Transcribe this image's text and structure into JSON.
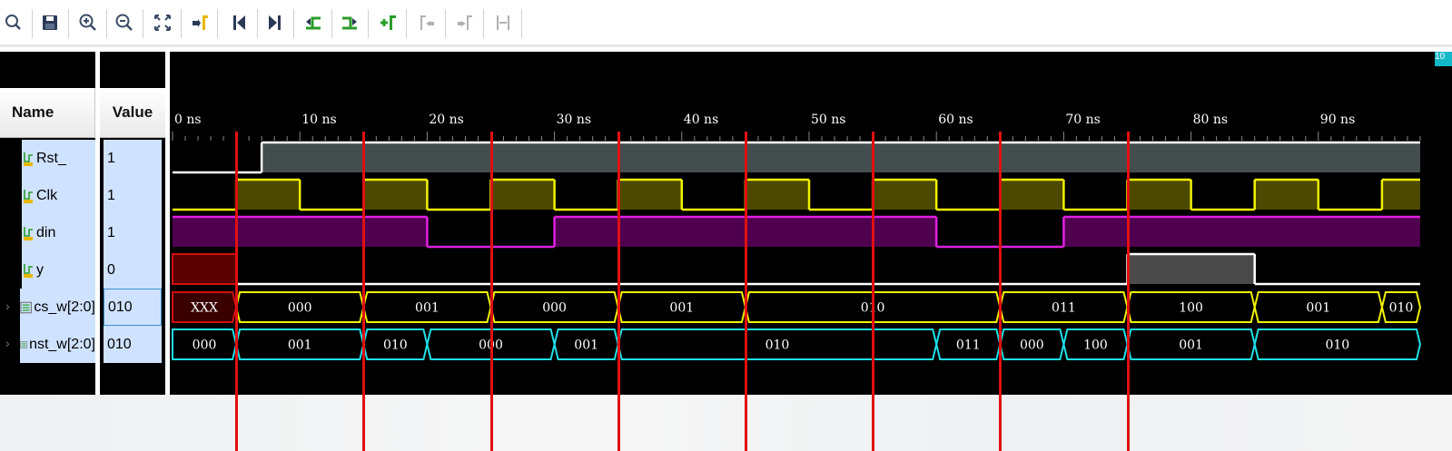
{
  "toolbar": {
    "buttons": [
      {
        "name": "search-icon",
        "enabled": true
      },
      {
        "name": "save-icon",
        "enabled": true
      },
      {
        "name": "zoom-in-icon",
        "enabled": true
      },
      {
        "name": "zoom-out-icon",
        "enabled": true
      },
      {
        "name": "zoom-fit-icon",
        "enabled": true
      },
      {
        "name": "go-to-cursor-icon",
        "enabled": true
      },
      {
        "name": "go-to-start-icon",
        "enabled": true
      },
      {
        "name": "go-to-end-icon",
        "enabled": true
      },
      {
        "name": "previous-transition-icon",
        "enabled": true
      },
      {
        "name": "next-transition-icon",
        "enabled": true
      },
      {
        "name": "add-marker-icon",
        "enabled": true
      },
      {
        "name": "previous-marker-icon",
        "enabled": false
      },
      {
        "name": "next-marker-icon",
        "enabled": false
      },
      {
        "name": "swap-cursors-icon",
        "enabled": false
      }
    ]
  },
  "headers": {
    "name": "Name",
    "value": "Value"
  },
  "signals": [
    {
      "name": "Rst_",
      "value": "1",
      "kind": "bit",
      "icon": "logic-signal-icon",
      "color": "#ffffff",
      "fill": "#444d4d"
    },
    {
      "name": "Clk",
      "value": "1",
      "kind": "bit",
      "icon": "logic-signal-icon",
      "color": "#f2f200",
      "fill": "#4d4a00"
    },
    {
      "name": "din",
      "value": "1",
      "kind": "bit",
      "icon": "logic-signal-icon",
      "color": "#e020e0",
      "fill": "#4f004f"
    },
    {
      "name": "y",
      "value": "0",
      "kind": "bit",
      "icon": "logic-signal-icon",
      "color": "#ffffff",
      "fill": "#4a4a4a"
    },
    {
      "name": "cs_w[2:0]",
      "value": "010",
      "kind": "bus",
      "icon": "bus-signal-icon",
      "color": "#f2f200",
      "selected": true
    },
    {
      "name": "nst_w[2:0]",
      "value": "010",
      "kind": "bus",
      "icon": "bus-signal-icon",
      "color": "#20e0e8"
    }
  ],
  "timeline": {
    "unit": "ns",
    "range_ns": [
      0,
      98
    ],
    "ticks": [
      {
        "t": 0,
        "label": "0 ns"
      },
      {
        "t": 10,
        "label": "10 ns"
      },
      {
        "t": 20,
        "label": "20 ns"
      },
      {
        "t": 30,
        "label": "30 ns"
      },
      {
        "t": 40,
        "label": "40 ns"
      },
      {
        "t": 50,
        "label": "50 ns"
      },
      {
        "t": 60,
        "label": "60 ns"
      },
      {
        "t": 70,
        "label": "70 ns"
      },
      {
        "t": 80,
        "label": "80 ns"
      },
      {
        "t": 90,
        "label": "90 ns"
      }
    ],
    "corner_label": "10"
  },
  "waves": {
    "Rst_": [
      {
        "t": 0,
        "v": 0
      },
      {
        "t": 7,
        "v": 1
      }
    ],
    "Clk": [
      {
        "t": 0,
        "v": 0
      },
      {
        "t": 5,
        "v": 1
      },
      {
        "t": 10,
        "v": 0
      },
      {
        "t": 15,
        "v": 1
      },
      {
        "t": 20,
        "v": 0
      },
      {
        "t": 25,
        "v": 1
      },
      {
        "t": 30,
        "v": 0
      },
      {
        "t": 35,
        "v": 1
      },
      {
        "t": 40,
        "v": 0
      },
      {
        "t": 45,
        "v": 1
      },
      {
        "t": 50,
        "v": 0
      },
      {
        "t": 55,
        "v": 1
      },
      {
        "t": 60,
        "v": 0
      },
      {
        "t": 65,
        "v": 1
      },
      {
        "t": 70,
        "v": 0
      },
      {
        "t": 75,
        "v": 1
      },
      {
        "t": 80,
        "v": 0
      },
      {
        "t": 85,
        "v": 1
      },
      {
        "t": 90,
        "v": 0
      },
      {
        "t": 95,
        "v": 1
      }
    ],
    "din": [
      {
        "t": 0,
        "v": 1
      },
      {
        "t": 20,
        "v": 0
      },
      {
        "t": 30,
        "v": 1
      },
      {
        "t": 60,
        "v": 0
      },
      {
        "t": 70,
        "v": 1
      }
    ],
    "y": [
      {
        "t": 0,
        "v": "x"
      },
      {
        "t": 5,
        "v": 0
      },
      {
        "t": 75,
        "v": 1
      },
      {
        "t": 85,
        "v": 0
      }
    ],
    "cs_w[2:0]": [
      {
        "t0": 0,
        "t1": 5,
        "label": "XXX",
        "x": true
      },
      {
        "t0": 5,
        "t1": 15,
        "label": "000"
      },
      {
        "t0": 15,
        "t1": 25,
        "label": "001"
      },
      {
        "t0": 25,
        "t1": 35,
        "label": "000"
      },
      {
        "t0": 35,
        "t1": 45,
        "label": "001"
      },
      {
        "t0": 45,
        "t1": 65,
        "label": "010"
      },
      {
        "t0": 65,
        "t1": 75,
        "label": "011"
      },
      {
        "t0": 75,
        "t1": 85,
        "label": "100"
      },
      {
        "t0": 85,
        "t1": 95,
        "label": "001"
      },
      {
        "t0": 95,
        "t1": 98,
        "label": "010"
      }
    ],
    "nst_w[2:0]": [
      {
        "t0": 0,
        "t1": 5,
        "label": "000"
      },
      {
        "t0": 5,
        "t1": 15,
        "label": "001"
      },
      {
        "t0": 15,
        "t1": 20,
        "label": "010"
      },
      {
        "t0": 20,
        "t1": 30,
        "label": "000"
      },
      {
        "t0": 30,
        "t1": 35,
        "label": "001"
      },
      {
        "t0": 35,
        "t1": 60,
        "label": "010"
      },
      {
        "t0": 60,
        "t1": 65,
        "label": "011"
      },
      {
        "t0": 65,
        "t1": 70,
        "label": "000"
      },
      {
        "t0": 70,
        "t1": 75,
        "label": "100"
      },
      {
        "t0": 75,
        "t1": 85,
        "label": "001"
      },
      {
        "t0": 85,
        "t1": 98,
        "label": "010"
      }
    ]
  },
  "annotation_lines_ns": [
    5,
    15,
    25,
    35,
    45,
    55,
    65,
    75
  ]
}
